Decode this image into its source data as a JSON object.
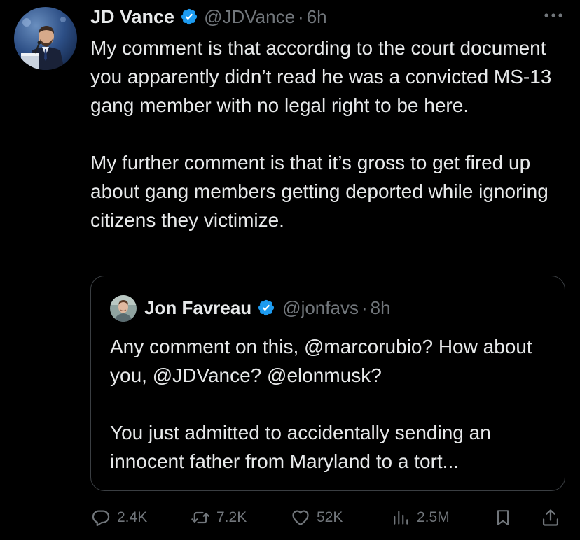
{
  "tweet": {
    "author": {
      "name": "JD Vance",
      "handle": "@JDVance",
      "separator": "·",
      "time": "6h",
      "avatar_icon": "avatar-photo"
    },
    "more_icon": "more-dots-icon",
    "paragraphs": [
      "My comment is that according to the court document you apparently didn’t read he was a convicted MS-13 gang member with no legal right to be here.",
      "My further comment is that it’s gross to get fired up about gang members getting deported while ignoring citizens they victimize."
    ],
    "quote": {
      "name": "Jon Favreau",
      "handle": "@jonfavs",
      "separator": "·",
      "time": "8h",
      "paragraphs": [
        "Any comment on this, @marcorubio? How about you, @JDVance? @elonmusk?",
        "You just admitted to accidentally sending an innocent father from Maryland to a tort..."
      ]
    },
    "actions": {
      "replies": "2.4K",
      "reposts": "7.2K",
      "likes": "52K",
      "views": "2.5M"
    }
  },
  "colors": {
    "background": "#000000",
    "text_primary": "#e7e9ea",
    "text_secondary": "#71767b",
    "verified_blue": "#1d9bf0",
    "border": "#3a3e42"
  }
}
